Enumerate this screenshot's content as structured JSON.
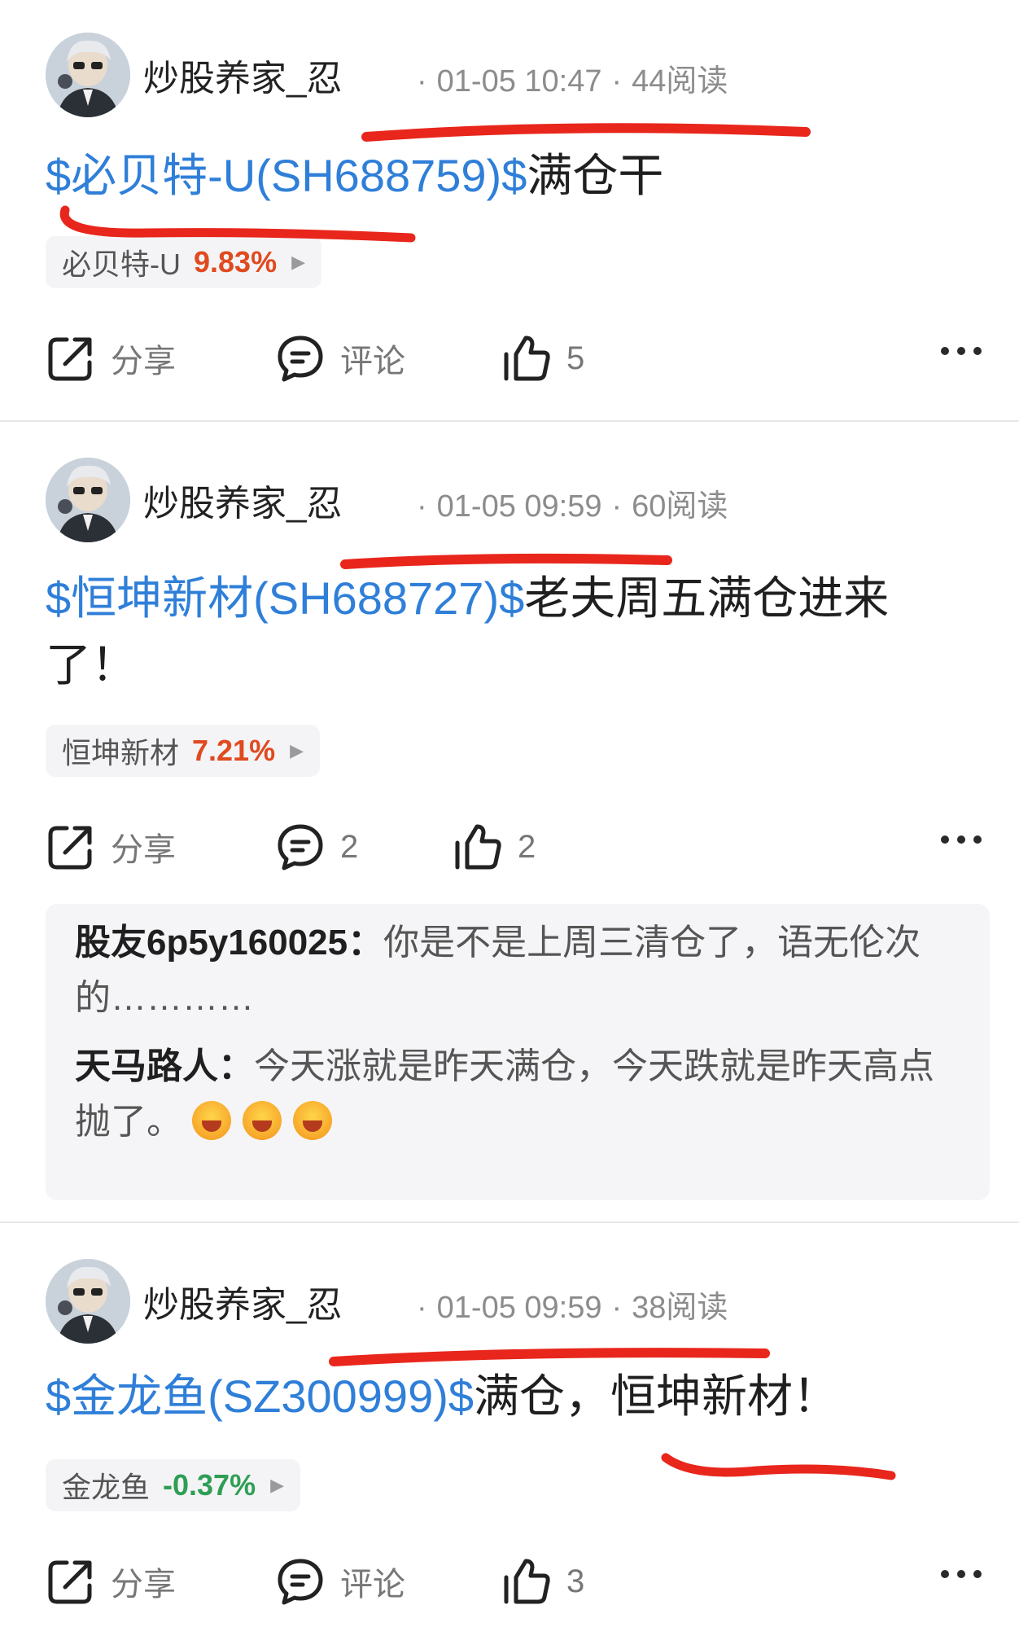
{
  "posts": [
    {
      "author": "炒股养家_忍",
      "time": "01-05 10:47",
      "reads": "44阅读",
      "stock_link": "$必贝特-U(SH688759)$",
      "text": "满仓干",
      "chip": {
        "name": "必贝特-U",
        "change": "9.83%",
        "change_color": "#e04a1f"
      },
      "share_label": "分享",
      "comment_label": "评论",
      "like_count": "5"
    },
    {
      "author": "炒股养家_忍",
      "time": "01-05 09:59",
      "reads": "60阅读",
      "stock_link": "$恒坤新材(SH688727)$",
      "text": "老夫周五满仓进来了！",
      "chip": {
        "name": "恒坤新材",
        "change": "7.21%",
        "change_color": "#e04a1f"
      },
      "share_label": "分享",
      "comment_label": "2",
      "like_count": "2",
      "comments": [
        {
          "author": "股友6p5y160025：",
          "text": "你是不是上周三清仓了，语无伦次的…………"
        },
        {
          "author": "天马路人：",
          "text": "今天涨就是昨天满仓，今天跌就是昨天高点抛了。"
        }
      ]
    },
    {
      "author": "炒股养家_忍",
      "time": "01-05 09:59",
      "reads": "38阅读",
      "stock_link": "$金龙鱼(SZ300999)$",
      "text": "满仓，恒坤新材！",
      "chip": {
        "name": "金龙鱼",
        "change": "-0.37%",
        "change_color": "#2f9e55"
      },
      "share_label": "分享",
      "comment_label": "评论",
      "like_count": "3"
    }
  ],
  "colors": {
    "link": "#2f7fd9",
    "annotation": "#e8261c"
  },
  "icons": [
    "avatar",
    "share-icon",
    "comment-icon",
    "like-icon",
    "more-icon",
    "chevron-right-icon",
    "laugh-emoji-icon"
  ]
}
